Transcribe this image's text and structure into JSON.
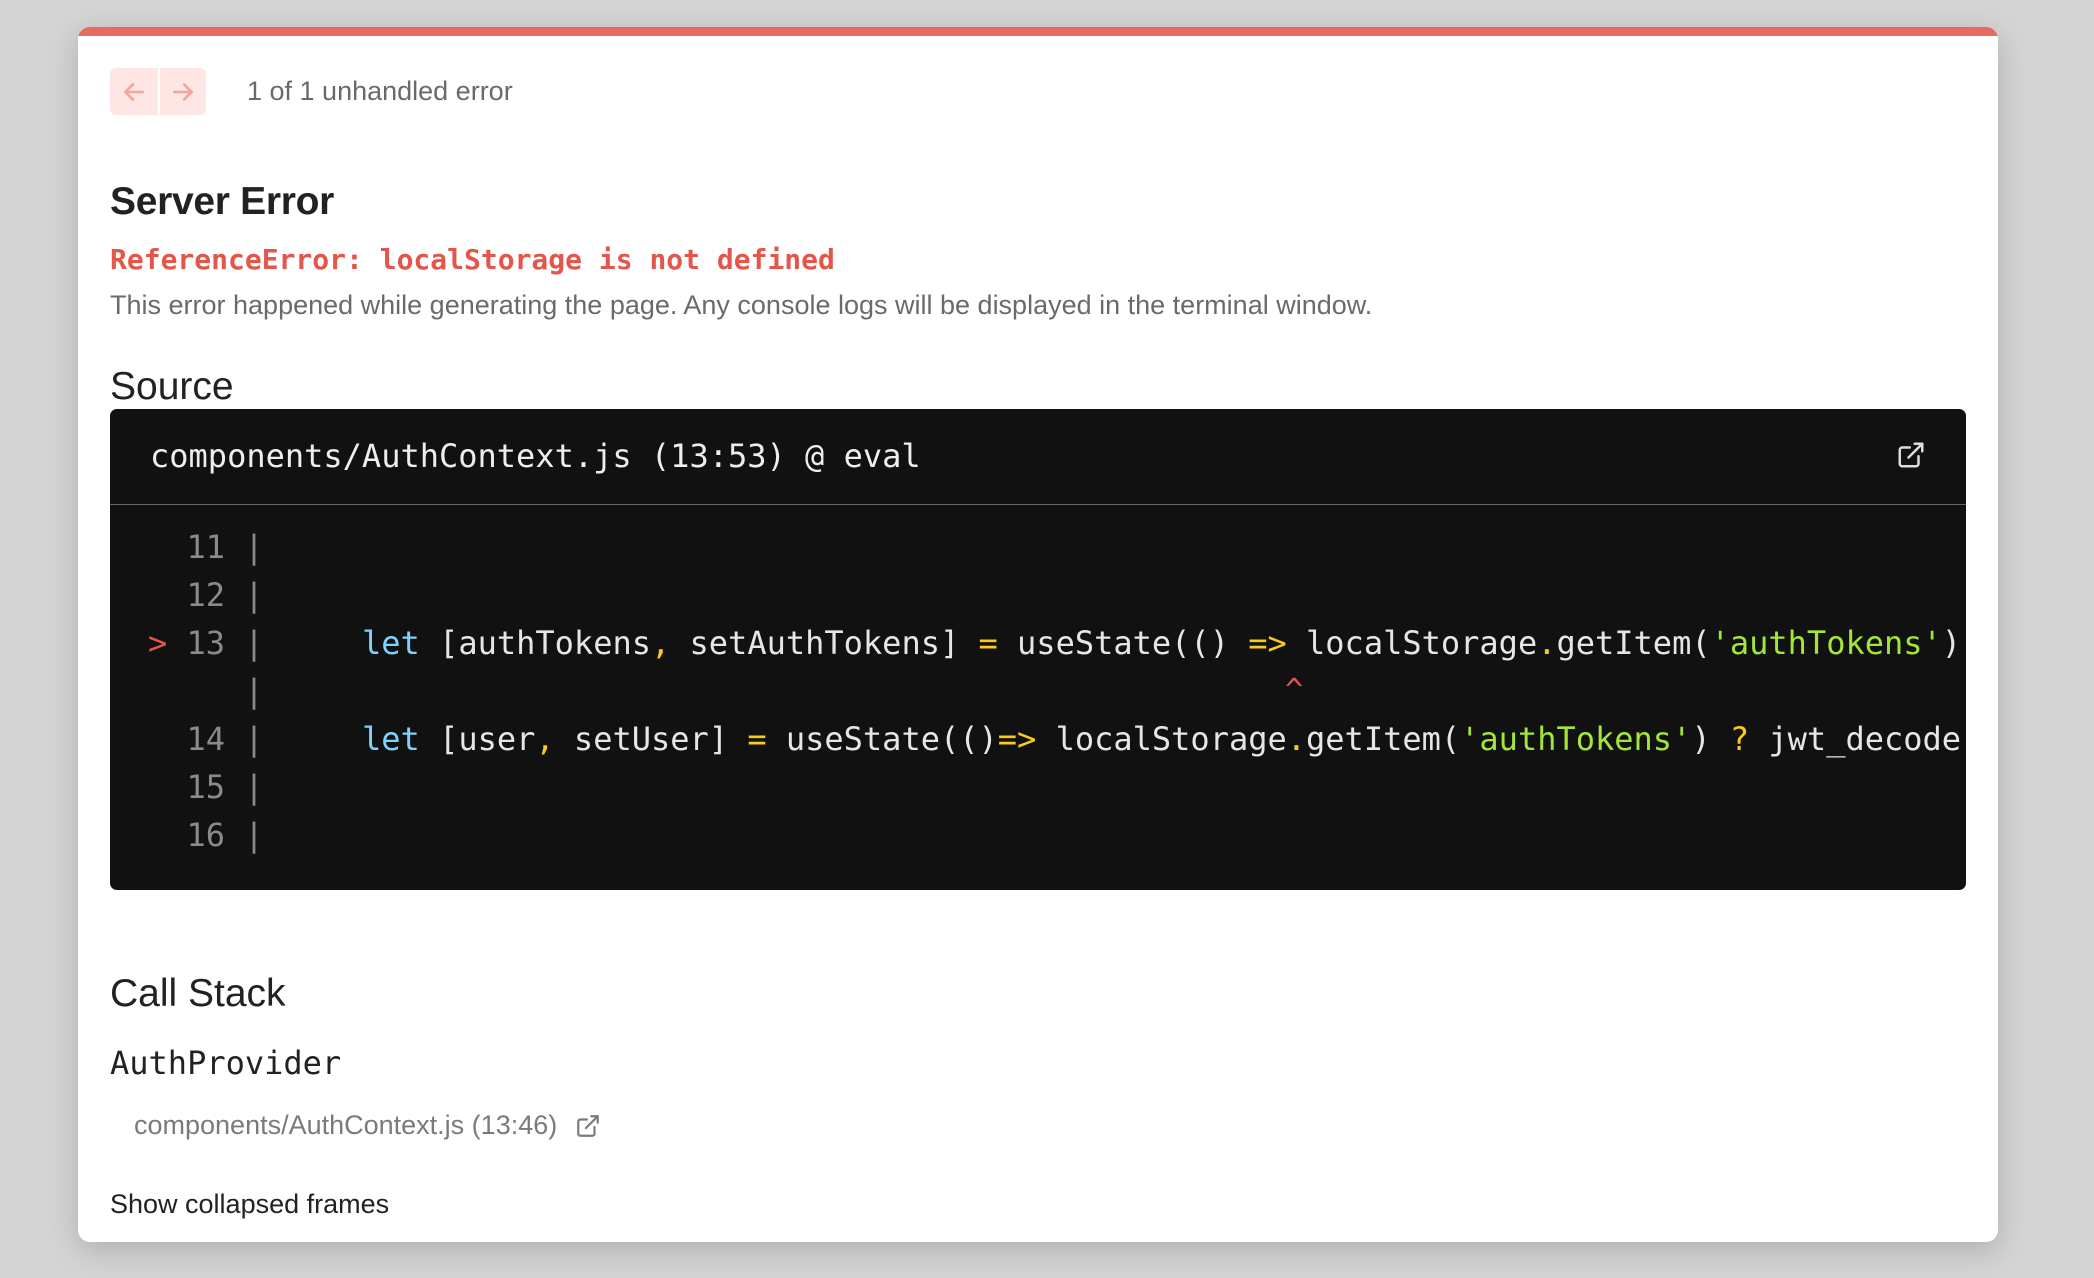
{
  "nav": {
    "count_text": "1 of 1 unhandled error"
  },
  "error": {
    "title": "Server Error",
    "message": "ReferenceError: localStorage is not defined",
    "description": "This error happened while generating the page. Any console logs will be displayed in the terminal window."
  },
  "source": {
    "heading": "Source",
    "file_ref": "components/AuthContext.js (13:53) @ eval",
    "lines": [
      {
        "gutter": "  11 |"
      },
      {
        "gutter": "  12 |"
      },
      {
        "gutter": "> 13 |"
      },
      {
        "gutter": "     |",
        "caret": "^"
      },
      {
        "gutter": "  14 |"
      },
      {
        "gutter": "  15 |"
      },
      {
        "gutter": "  16 |"
      }
    ],
    "code13": {
      "t1": "let",
      "t2": " [authTokens",
      "t3": ",",
      "t4": " setAuthTokens] ",
      "t5": "=",
      "t6": " useState(() ",
      "t7": "=>",
      "t8": " localStorage",
      "t9": ".",
      "t10": "getItem(",
      "t11": "'authTokens'",
      "t12": ")"
    },
    "code14": {
      "t1": "let",
      "t2": " [user",
      "t3": ",",
      "t4": " setUser] ",
      "t5": "=",
      "t6": " useState(()",
      "t7": "=>",
      "t8": " localStorage",
      "t9": ".",
      "t10": "getItem(",
      "t11": "'authTokens'",
      "t12": ") ",
      "t13": "?",
      "t14": " jwt_decode"
    }
  },
  "call_stack": {
    "heading": "Call Stack",
    "frame_fn": "AuthProvider",
    "frame_loc": "components/AuthContext.js (13:46)",
    "show_collapsed": "Show collapsed frames"
  },
  "colors": {
    "accent": "#e66b5e",
    "error_text": "#e5564a",
    "code_bg": "#111111",
    "keyword": "#7dd3fc",
    "operator": "#facc15",
    "string": "#a3e635"
  },
  "icons": [
    "arrow-left-icon",
    "arrow-right-icon",
    "external-link-icon"
  ]
}
